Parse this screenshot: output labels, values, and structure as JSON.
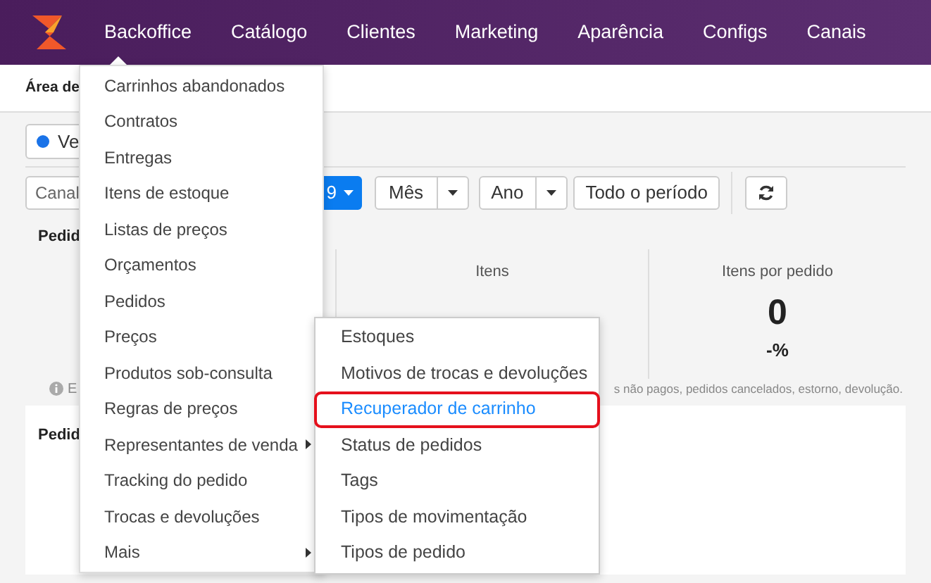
{
  "header": {
    "nav": [
      {
        "label": "Backoffice"
      },
      {
        "label": "Catálogo"
      },
      {
        "label": "Clientes"
      },
      {
        "label": "Marketing"
      },
      {
        "label": "Aparência"
      },
      {
        "label": "Configs"
      },
      {
        "label": "Canais"
      }
    ]
  },
  "page": {
    "title": "Área de",
    "channel_pill": "Ve",
    "filters": {
      "channel_placeholder": "Canal",
      "date_button": "9",
      "month": "Mês",
      "year": "Ano",
      "all_time": "Todo o período"
    },
    "section_title": "Pedid",
    "stats": [
      {
        "label": "Itens"
      },
      {
        "label": "Itens por pedido",
        "value": "0",
        "change": "-%"
      }
    ],
    "info_note": [
      "E",
      "s não pagos, pedidos cancelados, estorno, devolução."
    ],
    "card_title": "Pedid"
  },
  "menu": {
    "items": [
      {
        "label": "Carrinhos abandonados",
        "has_submenu": false
      },
      {
        "label": "Contratos",
        "has_submenu": false
      },
      {
        "label": "Entregas",
        "has_submenu": false
      },
      {
        "label": "Itens de estoque",
        "has_submenu": false
      },
      {
        "label": "Listas de preços",
        "has_submenu": false
      },
      {
        "label": "Orçamentos",
        "has_submenu": false
      },
      {
        "label": "Pedidos",
        "has_submenu": false
      },
      {
        "label": "Preços",
        "has_submenu": false
      },
      {
        "label": "Produtos sob-consulta",
        "has_submenu": false
      },
      {
        "label": "Regras de preços",
        "has_submenu": false
      },
      {
        "label": "Representantes de venda",
        "has_submenu": true
      },
      {
        "label": "Tracking do pedido",
        "has_submenu": false
      },
      {
        "label": "Trocas e devoluções",
        "has_submenu": false
      },
      {
        "label": "Mais",
        "has_submenu": true
      }
    ]
  },
  "submenu": {
    "items": [
      {
        "label": "Estoques",
        "selected": false
      },
      {
        "label": "Motivos de trocas e devoluções",
        "selected": false
      },
      {
        "label": "Recuperador de carrinho",
        "selected": true
      },
      {
        "label": "Status de pedidos",
        "selected": false
      },
      {
        "label": "Tags",
        "selected": false
      },
      {
        "label": "Tipos de movimentação",
        "selected": false
      },
      {
        "label": "Tipos de pedido",
        "selected": false
      }
    ]
  }
}
